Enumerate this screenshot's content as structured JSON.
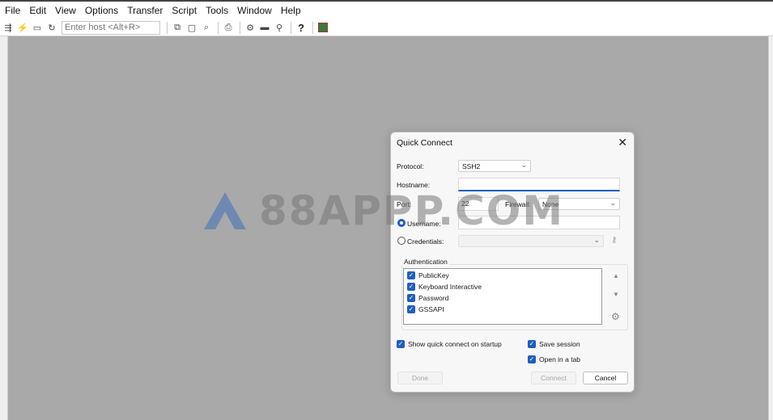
{
  "menu": [
    "File",
    "Edit",
    "View",
    "Options",
    "Transfer",
    "Script",
    "Tools",
    "Window",
    "Help"
  ],
  "toolbar": {
    "host_placeholder": "Enter host <Alt+R>",
    "help_label": "?"
  },
  "watermark": {
    "text": "88APPP.COM"
  },
  "dialog": {
    "title": "Quick Connect",
    "close_label": "✕",
    "protocol_label": "Protocol:",
    "protocol_value": "SSH2",
    "hostname_label": "Hostname:",
    "hostname_value": "",
    "port_label": "Port:",
    "port_value": "22",
    "firewall_label": "Firewall:",
    "firewall_value": "None",
    "username_label": "Username:",
    "username_value": "",
    "credentials_label": "Credentials:",
    "credentials_value": "",
    "auth_group_label": "Authentication",
    "auth_methods": [
      "PublicKey",
      "Keyboard Interactive",
      "Password",
      "GSSAPI"
    ],
    "show_quick_connect_label": "Show quick connect on startup",
    "save_session_label": "Save session",
    "open_in_tab_label": "Open in a tab",
    "done_label": "Done",
    "connect_label": "Connect",
    "cancel_label": "Cancel"
  },
  "colors": {
    "accent": "#1f5fbf",
    "background": "#a9a9a9"
  }
}
